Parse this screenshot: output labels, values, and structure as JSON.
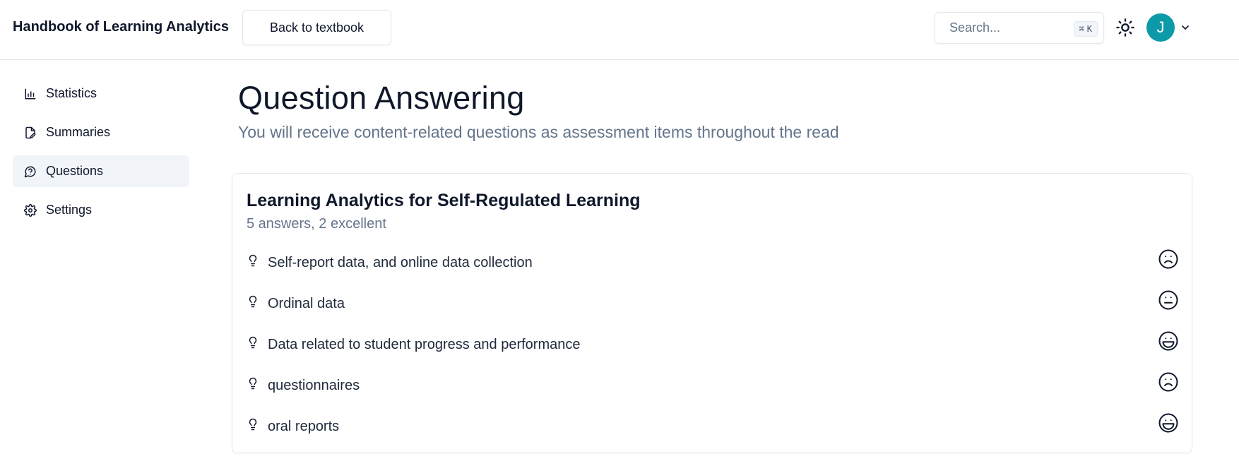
{
  "header": {
    "brand": "Handbook of Learning Analytics",
    "back_label": "Back to textbook",
    "search_placeholder": "Search...",
    "shortcut_symbol": "⌘",
    "shortcut_key": "K",
    "avatar_initial": "J"
  },
  "sidebar": {
    "items": [
      {
        "label": "Statistics",
        "icon": "bar-chart-icon",
        "active": false
      },
      {
        "label": "Summaries",
        "icon": "file-pen-icon",
        "active": false
      },
      {
        "label": "Questions",
        "icon": "message-question-icon",
        "active": true
      },
      {
        "label": "Settings",
        "icon": "gear-icon",
        "active": false
      }
    ]
  },
  "main": {
    "title": "Question Answering",
    "subtitle": "You will receive content-related questions as assessment items throughout the read"
  },
  "card": {
    "title": "Learning Analytics for Self-Regulated Learning",
    "summary": "5 answers, 2 excellent",
    "answers": [
      {
        "text": "Self-report data, and online data collection",
        "rating": "frown-icon"
      },
      {
        "text": "Ordinal data",
        "rating": "meh-icon"
      },
      {
        "text": "Data related to student progress and performance",
        "rating": "laugh-icon"
      },
      {
        "text": "questionnaires",
        "rating": "frown-icon"
      },
      {
        "text": "oral reports",
        "rating": "laugh-icon"
      }
    ]
  },
  "colors": {
    "accent_avatar": "#0d9aa8",
    "text_primary": "#0f172a",
    "text_muted": "#64748b",
    "border": "#e2e8f0",
    "active_bg": "#f1f5f9"
  }
}
